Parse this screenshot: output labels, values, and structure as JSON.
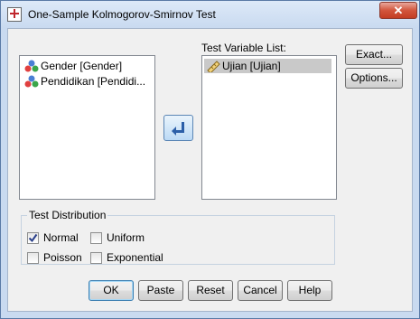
{
  "window": {
    "title": "One-Sample Kolmogorov-Smirnov Test",
    "close_glyph": "✕"
  },
  "variables": [
    {
      "label": "Gender [Gender]",
      "icon": "nominal-variable-icon"
    },
    {
      "label": "Pendidikan [Pendidi...",
      "icon": "nominal-variable-icon"
    }
  ],
  "test_list": {
    "label": "Test Variable List:",
    "items": [
      {
        "label": "Ujian [Ujian]",
        "icon": "scale-variable-icon"
      }
    ]
  },
  "side_buttons": {
    "exact": "Exact...",
    "options": "Options..."
  },
  "test_distribution": {
    "legend": "Test Distribution",
    "options": [
      {
        "label": "Normal",
        "checked": true
      },
      {
        "label": "Uniform",
        "checked": false
      },
      {
        "label": "Poisson",
        "checked": false
      },
      {
        "label": "Exponential",
        "checked": false
      }
    ]
  },
  "footer_buttons": {
    "ok": "OK",
    "paste": "Paste",
    "reset": "Reset",
    "cancel": "Cancel",
    "help": "Help"
  },
  "colors": {
    "accent": "#3c7fb1",
    "selection": "#c9c9c9",
    "close_button": "#c33d22"
  }
}
